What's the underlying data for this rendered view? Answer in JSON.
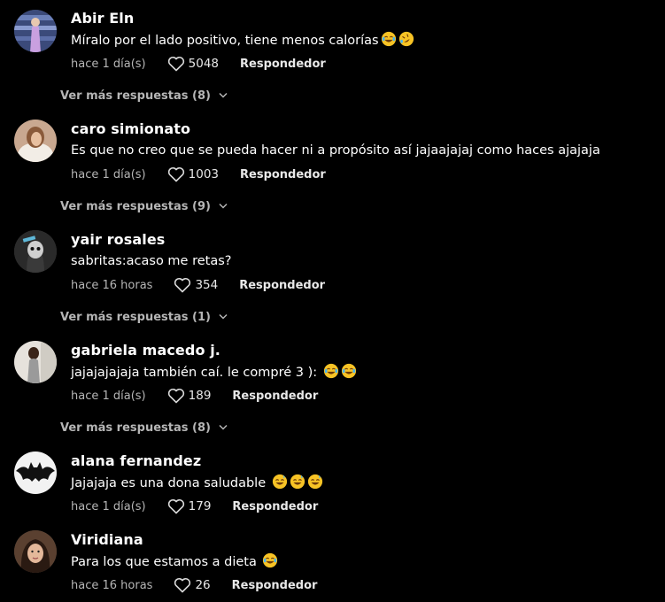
{
  "comments": [
    {
      "username": "Abir Eln",
      "text": "Míralo por el lado positivo, tiene menos calorías",
      "emojis": [
        "face-with-tears-of-joy-icon",
        "rolling-on-floor-laughing-icon"
      ],
      "time": "hace 1 día(s)",
      "likes": "5048",
      "reply_label": "Respondedor",
      "more_replies": "Ver más respuestas (8)"
    },
    {
      "username": "caro simionato",
      "text": "Es que no creo que se pueda hacer ni a propósito así jajaajajaj como haces ajajaja",
      "emojis": [],
      "time": "hace 1 día(s)",
      "likes": "1003",
      "reply_label": "Respondedor",
      "more_replies": "Ver más respuestas (9)"
    },
    {
      "username": "yair rosales",
      "text": "sabritas:acaso me retas?",
      "emojis": [],
      "time": "hace 16 horas",
      "likes": "354",
      "reply_label": "Respondedor",
      "more_replies": "Ver más respuestas (1)"
    },
    {
      "username": "gabriela macedo j.",
      "text": "jajajajajaja también caí. le compré 3 ):",
      "emojis": [
        "face-with-tears-of-joy-icon",
        "face-with-tears-of-joy-icon"
      ],
      "time": "hace 1 día(s)",
      "likes": "189",
      "reply_label": "Respondedor",
      "more_replies": "Ver más respuestas (8)"
    },
    {
      "username": "alana fernandez",
      "text": "Jajajaja es una dona saludable",
      "emojis": [
        "grinning-face-with-sweat-icon",
        "grinning-face-with-sweat-icon",
        "grinning-face-with-sweat-icon"
      ],
      "time": "hace 1 día(s)",
      "likes": "179",
      "reply_label": "Respondedor",
      "more_replies": ""
    },
    {
      "username": "Viridiana",
      "text": "Para los que estamos a dieta",
      "emojis": [
        "face-with-tears-of-joy-icon"
      ],
      "time": "hace 16 horas",
      "likes": "26",
      "reply_label": "Respondedor",
      "more_replies": ""
    }
  ],
  "colors": {
    "background": "#000000",
    "text": "#ffffff",
    "muted": "#b5b5b5",
    "emoji_yellow": "#f7c325"
  }
}
